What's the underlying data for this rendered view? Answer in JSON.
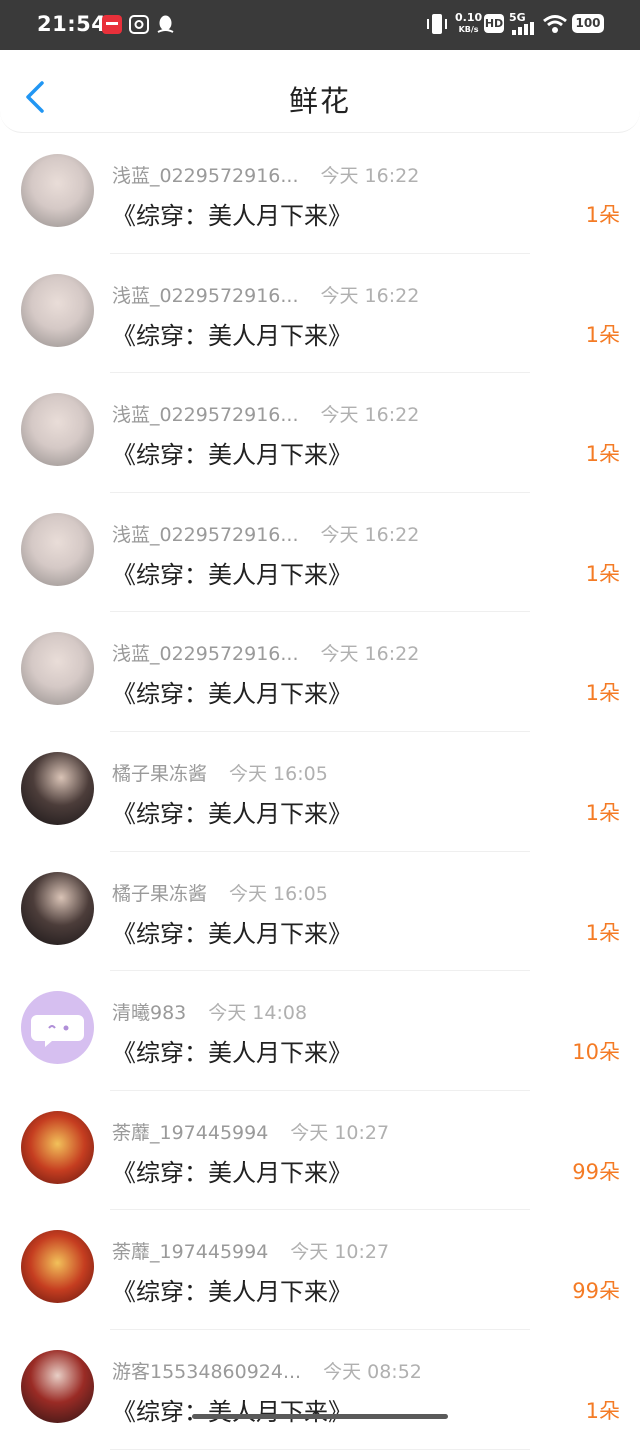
{
  "status_bar": {
    "time": "21:54",
    "net_speed_top": "0.10",
    "net_speed_unit": "KB/s",
    "hd": "HD",
    "signal": "5G",
    "battery": "100"
  },
  "header": {
    "title": "鲜花",
    "back_icon": "chevron-left-icon",
    "accent_color": "#2196f3"
  },
  "rows": [
    {
      "user": "浅蓝_0229572916...",
      "time": "今天 16:22",
      "book": "《综穿：美人月下来》",
      "count": "1朵",
      "avatar": "pale"
    },
    {
      "user": "浅蓝_0229572916...",
      "time": "今天 16:22",
      "book": "《综穿：美人月下来》",
      "count": "1朵",
      "avatar": "pale"
    },
    {
      "user": "浅蓝_0229572916...",
      "time": "今天 16:22",
      "book": "《综穿：美人月下来》",
      "count": "1朵",
      "avatar": "pale"
    },
    {
      "user": "浅蓝_0229572916...",
      "time": "今天 16:22",
      "book": "《综穿：美人月下来》",
      "count": "1朵",
      "avatar": "pale"
    },
    {
      "user": "浅蓝_0229572916...",
      "time": "今天 16:22",
      "book": "《综穿：美人月下来》",
      "count": "1朵",
      "avatar": "pale"
    },
    {
      "user": "橘子果冻酱",
      "time": "今天 16:05",
      "book": "《综穿：美人月下来》",
      "count": "1朵",
      "avatar": "dark"
    },
    {
      "user": "橘子果冻酱",
      "time": "今天 16:05",
      "book": "《综穿：美人月下来》",
      "count": "1朵",
      "avatar": "dark"
    },
    {
      "user": "清曦983",
      "time": "今天 14:08",
      "book": "《综穿：美人月下来》",
      "count": "10朵",
      "avatar": "purple"
    },
    {
      "user": "荼蘼_197445994",
      "time": "今天 10:27",
      "book": "《综穿：美人月下来》",
      "count": "99朵",
      "avatar": "opera"
    },
    {
      "user": "荼蘼_197445994",
      "time": "今天 10:27",
      "book": "《综穿：美人月下来》",
      "count": "99朵",
      "avatar": "opera"
    },
    {
      "user": "游客15534860924...",
      "time": "今天 08:52",
      "book": "《综穿：美人月下来》",
      "count": "1朵",
      "avatar": "red"
    }
  ],
  "colors": {
    "count": "#f47b25",
    "status_bar_bg": "#3a3a3a"
  }
}
